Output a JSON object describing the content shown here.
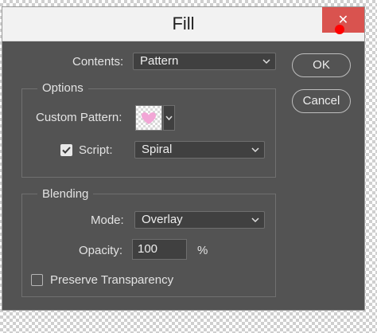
{
  "window": {
    "title": "Fill",
    "close_glyph": "✕"
  },
  "contents": {
    "label": "Contents:",
    "value": "Pattern"
  },
  "buttons": {
    "ok": "OK",
    "cancel": "Cancel"
  },
  "options": {
    "group_title": "Options",
    "custom_pattern_label": "Custom Pattern:",
    "script_checkbox_checked": true,
    "script_label": "Script:",
    "script_value": "Spiral"
  },
  "blending": {
    "group_title": "Blending",
    "mode_label": "Mode:",
    "mode_value": "Overlay",
    "opacity_label": "Opacity:",
    "opacity_value": "100",
    "opacity_unit": "%",
    "preserve_transparency_label": "Preserve Transparency",
    "preserve_transparency_checked": false
  },
  "colors": {
    "dialog_bg": "#535353",
    "close_bg": "#d9534f",
    "cursor": "#ff0000"
  },
  "icons": {
    "dropdown": "chevron-down-icon",
    "check": "checkmark-icon",
    "close": "close-icon"
  }
}
